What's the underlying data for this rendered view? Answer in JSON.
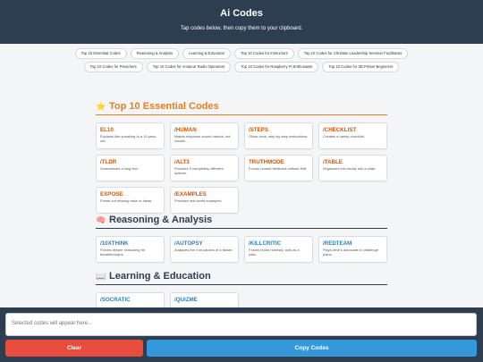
{
  "header": {
    "title": "Ai Codes",
    "subtitle": "Tap codes below, then copy them to your clipboard."
  },
  "chips": [
    "Top 10 Essential Codes",
    "Reasoning & Analysis",
    "Learning & Education",
    "Top 10 Codes for Instructors",
    "Top 10 Codes for Christian Leadership Seminar Facilitators",
    "Top 10 Codes for Preachers",
    "Top 10 Codes for Amateur Radio Operators",
    "Top 10 Codes for Raspberry Pi Enthusiasts",
    "Top 10 Codes for 3D Printer Beginners"
  ],
  "sections": {
    "essential": {
      "icon": "⭐",
      "title": "Top 10 Essential Codes",
      "cards": [
        {
          "code": "EL10",
          "desc": "Explains like speaking to a 10-year-old."
        },
        {
          "code": "/HUMAN",
          "desc": "Makes response sound natural, not robotic."
        },
        {
          "code": "/STEPS",
          "desc": "Gives clear, step-by-step instructions."
        },
        {
          "code": "/CHECKLIST",
          "desc": "Creates a handy checklist."
        },
        {
          "code": "/TLDR",
          "desc": "Summarizes a long text."
        },
        {
          "code": "/ALT3",
          "desc": "Provides 3 completely different options."
        },
        {
          "code": "TRUTHMODE",
          "desc": "Forces honest feedback without fluff."
        },
        {
          "code": "/TABLE",
          "desc": "Organizes info neatly into a chart."
        },
        {
          "code": "EXPOSE",
          "desc": "Points out missing risks or ideas."
        },
        {
          "code": "/EXAMPLES",
          "desc": "Provides real-world examples."
        }
      ]
    },
    "reasoning": {
      "icon": "🧠",
      "title": "Reasoning & Analysis",
      "cards": [
        {
          "code": "/10XTHINK",
          "desc": "Forces deeper reasoning for breakthroughs."
        },
        {
          "code": "/AUTOPSY",
          "desc": "Analyzes the root causes of a failure."
        },
        {
          "code": "/KILLCRITIC",
          "desc": "Forces brutal honesty; acts as a critic."
        },
        {
          "code": "/REDTEAM",
          "desc": "Plays devil's advocate to challenge plans."
        }
      ]
    },
    "learning": {
      "icon": "📖",
      "title": "Learning & Education",
      "cards": [
        {
          "code": "/SOCRATIC",
          "desc": ""
        },
        {
          "code": "/QUIZME",
          "desc": ""
        }
      ]
    }
  },
  "output": {
    "placeholder": "Selected codes will appear here..."
  },
  "buttons": {
    "clear": "Clear",
    "copy": "Copy Codes"
  }
}
